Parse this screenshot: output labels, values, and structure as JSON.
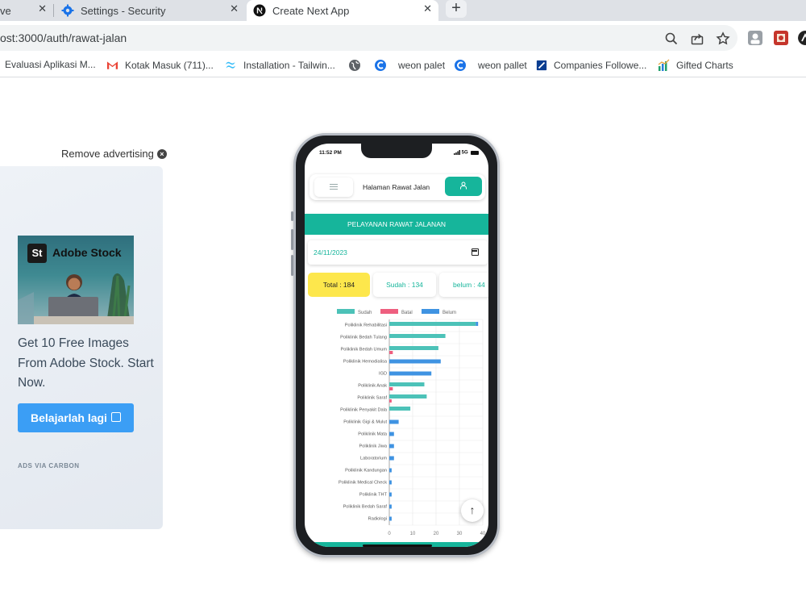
{
  "browser": {
    "tabs": [
      {
        "title": "ve",
        "active": false
      },
      {
        "title": "Settings - Security",
        "active": false
      },
      {
        "title": "Create Next App",
        "active": true
      }
    ],
    "close_glyph": "✕",
    "new_tab_glyph": "+",
    "url": "ost:3000/auth/rawat-jalan",
    "bookmarks": [
      {
        "label": "Evaluasi Aplikasi M...",
        "icon": "none"
      },
      {
        "label": "Kotak Masuk (711)...",
        "icon": "gmail-icon"
      },
      {
        "label": "Installation - Tailwin...",
        "icon": "tailwind-icon"
      },
      {
        "label": "",
        "icon": "globe-icon"
      },
      {
        "label": "weon palet",
        "icon": "c-icon"
      },
      {
        "label": "weon pallet",
        "icon": "c-icon"
      },
      {
        "label": "Companies Followe...",
        "icon": "linkedin-icon"
      },
      {
        "label": "Gifted Charts",
        "icon": "chart-icon"
      }
    ]
  },
  "ad": {
    "remove_label": "Remove advertising",
    "brand_logo": "St",
    "brand_name": "Adobe Stock",
    "text": "Get 10 Free Images From Adobe Stock. Start Now.",
    "button_label": "Belajarlah lagi",
    "via": "ADS VIA CARBON",
    "button_color": "#3b9ef5"
  },
  "phone": {
    "status_time": "11:52 PM",
    "status_network": "5G",
    "header_title": "Halaman Rawat Jalan",
    "section_title": "PELAYANAN RAWAT JALANAN",
    "date_value": "24/11/2023",
    "stats": {
      "total": "Total : 184",
      "sudah": "Sudah : 134",
      "belum": "belum : 44"
    },
    "accent_color": "#16b59b",
    "scroll_top_glyph": "↑"
  },
  "chart_data": {
    "type": "bar",
    "orientation": "horizontal",
    "legend_position": "top",
    "grid": true,
    "xlim": [
      0,
      40
    ],
    "xticks": [
      "0",
      "10",
      "20",
      "30",
      "40"
    ],
    "categories": [
      "Poliklinik Rehabilitasi Medik",
      "Poliklinik Bedah Tulang",
      "Poliklinik Bedah Umum",
      "Poliklinik Hemodialisa",
      "IGD",
      "Poliklinik Anak",
      "Poliklinik Saraf",
      "Poliklinik Penyakit Dalam",
      "Poliklinik Gigi & Mulut",
      "Poliklinik Mata",
      "Poliklinik Jiwa",
      "Laboratorium",
      "Poliklinik Kandungan",
      "Poliklinik Medical Check Up",
      "Poliklinik THT",
      "Poliklinik Bedah Saraf",
      "Radiologi"
    ],
    "series": [
      {
        "name": "Sudah",
        "color": "#4cc2b8",
        "values": [
          37,
          24,
          21,
          0,
          0,
          15,
          16,
          9,
          0,
          0,
          0,
          0,
          0,
          0,
          0,
          0,
          0
        ]
      },
      {
        "name": "Batal",
        "color": "#ee5f7f",
        "values": [
          0,
          0,
          1.5,
          0,
          0,
          1.5,
          1,
          0,
          0,
          0,
          0,
          0,
          0,
          0,
          0,
          0,
          0
        ]
      },
      {
        "name": "Belum",
        "color": "#3f93e2",
        "values": [
          1,
          0,
          0,
          22,
          18,
          0,
          0,
          0,
          4,
          2,
          2,
          2,
          1,
          1,
          1,
          1,
          1
        ]
      }
    ]
  }
}
